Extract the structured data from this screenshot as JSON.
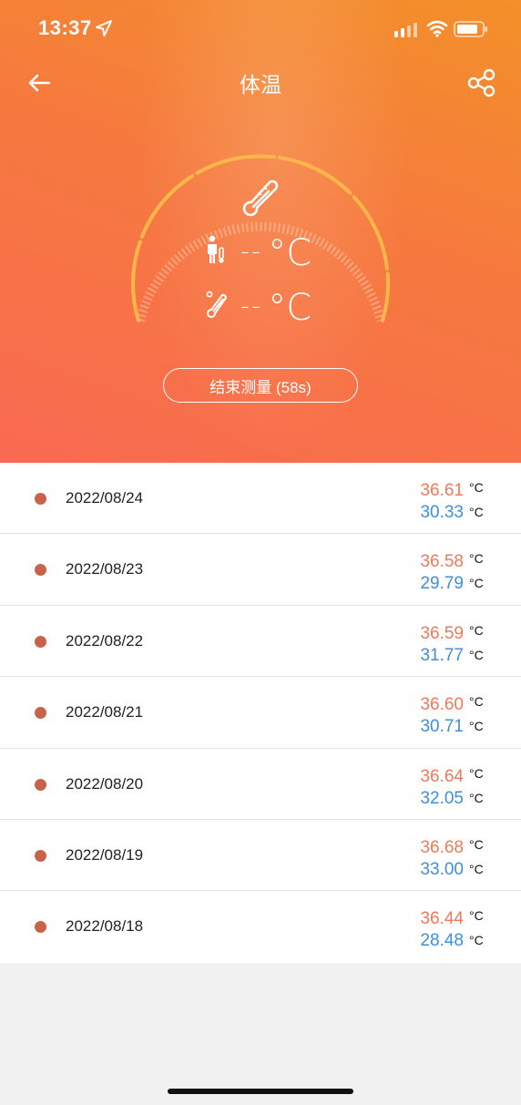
{
  "status_bar": {
    "time": "13:37"
  },
  "nav": {
    "title": "体温"
  },
  "gauge": {
    "body_temp": "-- °C",
    "probe_temp": "-- °C"
  },
  "end_button_label": "结束测量 (58s)",
  "records": [
    {
      "date": "2022/08/24",
      "body": "36.61",
      "surface": "30.33",
      "unit": "°C"
    },
    {
      "date": "2022/08/23",
      "body": "36.58",
      "surface": "29.79",
      "unit": "°C"
    },
    {
      "date": "2022/08/22",
      "body": "36.59",
      "surface": "31.77",
      "unit": "°C"
    },
    {
      "date": "2022/08/21",
      "body": "36.60",
      "surface": "30.71",
      "unit": "°C"
    },
    {
      "date": "2022/08/20",
      "body": "36.64",
      "surface": "32.05",
      "unit": "°C"
    },
    {
      "date": "2022/08/19",
      "body": "36.68",
      "surface": "33.00",
      "unit": "°C"
    },
    {
      "date": "2022/08/18",
      "body": "36.44",
      "surface": "28.48",
      "unit": "°C"
    }
  ],
  "colors": {
    "header_top": "#f39029",
    "header_bottom": "#f96a52",
    "body_value": "#ef7a5a",
    "surface_value": "#3e8fdb",
    "dot": "#c9624a"
  },
  "icons": {
    "location": "location-arrow-icon",
    "signal": "cellular-signal-icon",
    "wifi": "wifi-icon",
    "battery": "battery-icon",
    "back": "back-arrow-icon",
    "share": "share-icon",
    "thermometer": "thermometer-icon",
    "person": "person-icon",
    "probe": "probe-thermometer-icon"
  }
}
